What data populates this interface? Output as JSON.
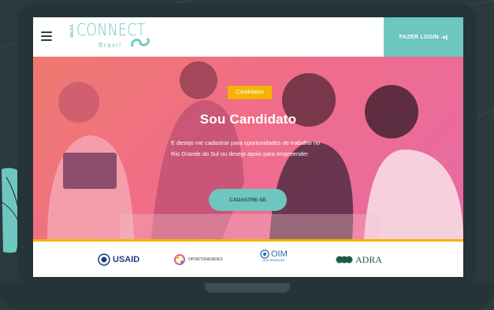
{
  "header": {
    "logo_main": "CONNECT",
    "logo_sub": "MIGRA",
    "logo_country": "Brasil",
    "login_label": "FAZER LOGIN"
  },
  "hero": {
    "badge": "Candidatos",
    "title": "Sou Candidato",
    "description": "E desejo me cadastrar para oportunidades de trabalho no Rio Grande do Sul ou desejo apoio para empreender",
    "cta_label": "CADASTRE-SE"
  },
  "partners": {
    "usaid": "USAID",
    "oportunidades": "OPORTUNIDADES",
    "oim": "OIM",
    "oim_sub": "ONU MIGRAÇÃO",
    "adra": "ADRA"
  },
  "colors": {
    "accent": "#6ec7be",
    "badge": "#f5b400",
    "hero_pink": "#f06d88",
    "device": "#243437"
  }
}
